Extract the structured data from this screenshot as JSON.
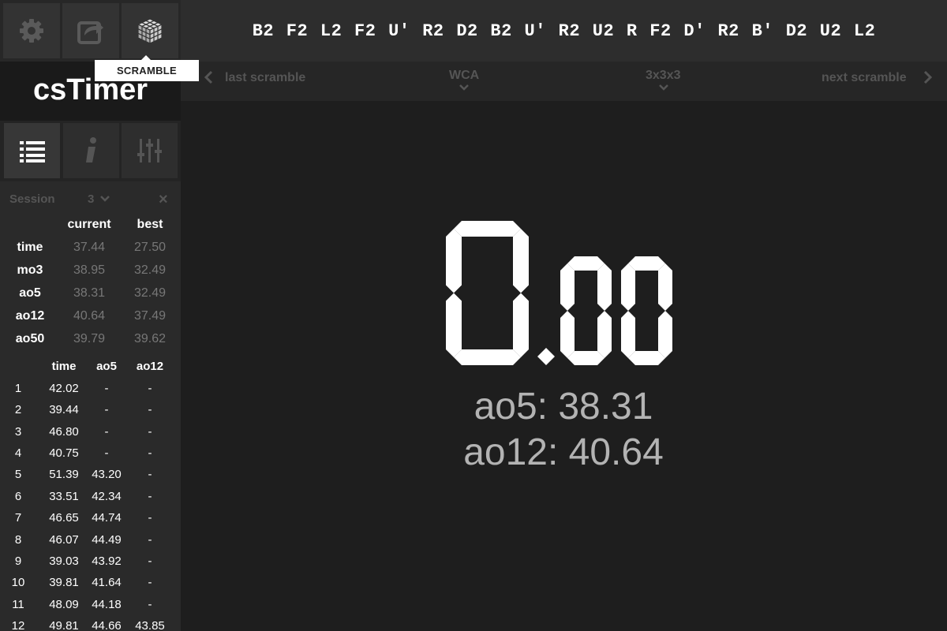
{
  "scramble": {
    "text": "B2 F2 L2 F2 U' R2 D2 B2 U' R2 U2 R F2 D' R2 B' D2 U2 L2",
    "prev_label": "last scramble",
    "next_label": "next scramble",
    "event_group": "WCA",
    "event_type": "3x3x3",
    "tooltip": "SCRAMBLE"
  },
  "app": {
    "logo": "csTimer"
  },
  "toolbar": {
    "icons": [
      "gear-icon",
      "export-icon",
      "cube-icon"
    ],
    "row_icons": [
      "list-icon",
      "info-icon",
      "sliders-icon"
    ]
  },
  "session": {
    "label": "Session",
    "number": "3",
    "close": "×"
  },
  "stats": {
    "headers": [
      "current",
      "best"
    ],
    "rows": [
      {
        "label": "time",
        "current": "37.44",
        "best": "27.50"
      },
      {
        "label": "mo3",
        "current": "38.95",
        "best": "32.49"
      },
      {
        "label": "ao5",
        "current": "38.31",
        "best": "32.49"
      },
      {
        "label": "ao12",
        "current": "40.64",
        "best": "37.49"
      },
      {
        "label": "ao50",
        "current": "39.79",
        "best": "39.62"
      }
    ]
  },
  "history": {
    "headers": [
      "time",
      "ao5",
      "ao12"
    ],
    "rows": [
      {
        "idx": "1",
        "time": "42.02",
        "ao5": "-",
        "ao12": "-"
      },
      {
        "idx": "2",
        "time": "39.44",
        "ao5": "-",
        "ao12": "-"
      },
      {
        "idx": "3",
        "time": "46.80",
        "ao5": "-",
        "ao12": "-"
      },
      {
        "idx": "4",
        "time": "40.75",
        "ao5": "-",
        "ao12": "-"
      },
      {
        "idx": "5",
        "time": "51.39",
        "ao5": "43.20",
        "ao12": "-"
      },
      {
        "idx": "6",
        "time": "33.51",
        "ao5": "42.34",
        "ao12": "-"
      },
      {
        "idx": "7",
        "time": "46.65",
        "ao5": "44.74",
        "ao12": "-"
      },
      {
        "idx": "8",
        "time": "46.07",
        "ao5": "44.49",
        "ao12": "-"
      },
      {
        "idx": "9",
        "time": "39.03",
        "ao5": "43.92",
        "ao12": "-"
      },
      {
        "idx": "10",
        "time": "39.81",
        "ao5": "41.64",
        "ao12": "-"
      },
      {
        "idx": "11",
        "time": "48.09",
        "ao5": "44.18",
        "ao12": "-"
      },
      {
        "idx": "12",
        "time": "49.81",
        "ao5": "44.66",
        "ao12": "43.85"
      }
    ]
  },
  "timer": {
    "display": "0.00",
    "ao5_text": "ao5: 38.31",
    "ao12_text": "ao12: 40.64"
  },
  "colors": {
    "background": "#1e1e1e",
    "panel": "#2a2a2a",
    "text": "#ffffff",
    "muted": "#777777",
    "average": "#b3b3b3"
  }
}
